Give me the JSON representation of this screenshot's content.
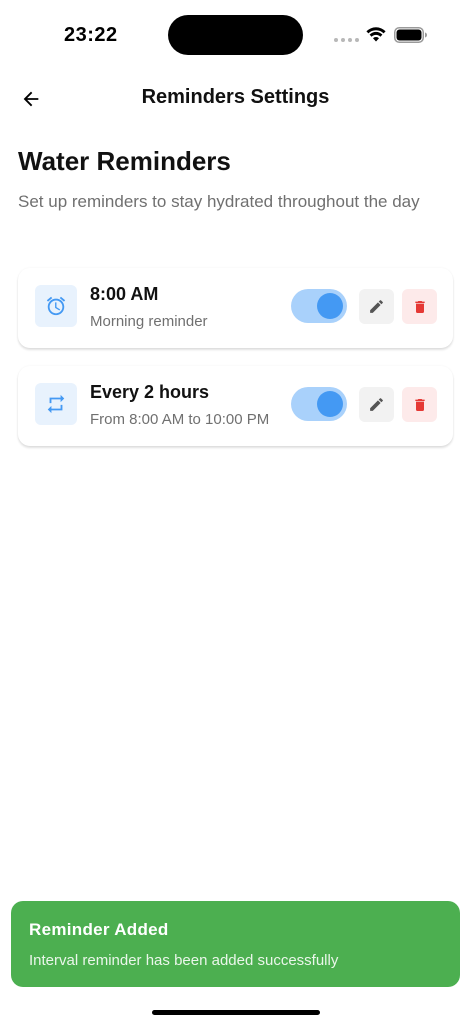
{
  "status_bar": {
    "time": "23:22",
    "icons": [
      "cellular-dots-icon",
      "wifi-icon",
      "battery-icon"
    ]
  },
  "header": {
    "title": "Reminders Settings",
    "back_icon": "arrow-left-icon"
  },
  "page": {
    "title": "Water Reminders",
    "subtitle": "Set up reminders to stay hydrated throughout the day"
  },
  "reminders": [
    {
      "icon": "alarm-clock-icon",
      "title": "8:00 AM",
      "subtitle": "Morning reminder",
      "enabled": true
    },
    {
      "icon": "repeat-icon",
      "title": "Every 2 hours",
      "subtitle": "From 8:00 AM to 10:00 PM",
      "enabled": true
    }
  ],
  "toast": {
    "title": "Reminder Added",
    "message": "Interval reminder has been added successfully"
  },
  "colors": {
    "accent": "#4499f3",
    "accent_light": "#a9d1fb",
    "icon_bg": "#e8f2fd",
    "delete": "#e53935",
    "delete_bg": "#fdeaea",
    "toast_bg": "#4caf50"
  }
}
